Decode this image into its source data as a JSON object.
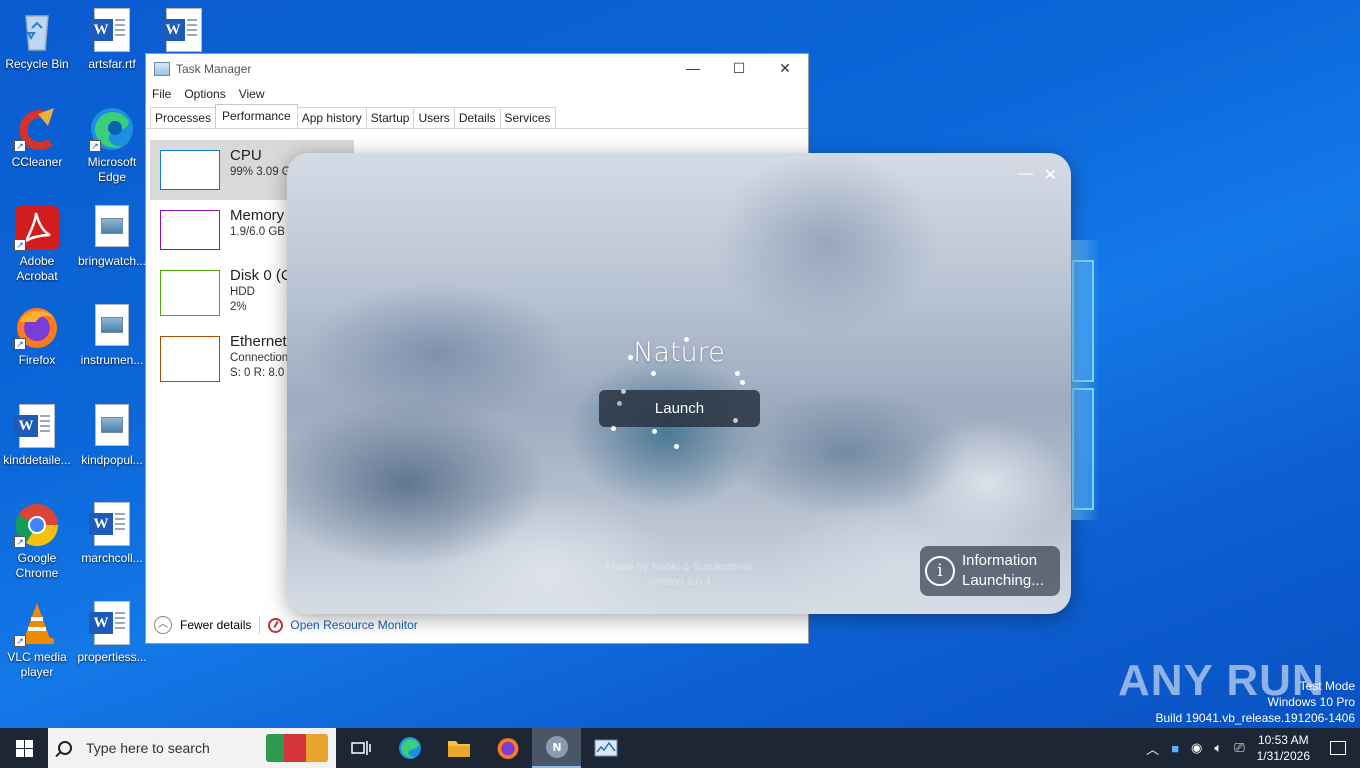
{
  "desktop": {
    "icons": [
      {
        "label": "Recycle Bin"
      },
      {
        "label": "artsfar.rtf"
      },
      {
        "label": ""
      },
      {
        "label": "CCleaner"
      },
      {
        "label": "Microsoft Edge"
      },
      {
        "label": "Adobe Acrobat"
      },
      {
        "label": "bringwatch..."
      },
      {
        "label": "Firefox"
      },
      {
        "label": "instrumen..."
      },
      {
        "label": "kinddetaile..."
      },
      {
        "label": "kindpopul..."
      },
      {
        "label": "Google Chrome"
      },
      {
        "label": "marchcoll..."
      },
      {
        "label": "VLC media player"
      },
      {
        "label": "propertiess..."
      }
    ]
  },
  "task_manager": {
    "title": "Task Manager",
    "menu": [
      "File",
      "Options",
      "View"
    ],
    "tabs": [
      "Processes",
      "Performance",
      "App history",
      "Startup",
      "Users",
      "Details",
      "Services"
    ],
    "active_tab": "Performance",
    "resources": [
      {
        "name": "CPU",
        "line1": "99%  3.09 GHz",
        "line2": "",
        "color": "#117dbb"
      },
      {
        "name": "Memory",
        "line1": "1.9/6.0 GB (32%)",
        "line2": "",
        "color": "#8b12ae"
      },
      {
        "name": "Disk 0 (C:)",
        "line1": "HDD",
        "line2": "2%",
        "color": "#4da60c"
      },
      {
        "name": "Ethernet",
        "line1": "Connection",
        "line2": "S: 0 R: 8.0 Kbps",
        "color": "#a74f01"
      }
    ],
    "footer": {
      "fewer_details": "Fewer details",
      "open_resource_monitor": "Open Resource Monitor"
    }
  },
  "launcher": {
    "title": "Nature",
    "launch_button": "Launch",
    "credits_line1": "Made by Naoki & Surukotonai",
    "credits_line2": "Version 1.0.4",
    "info_title": "Information",
    "info_status": "Launching..."
  },
  "watermark": {
    "brand": "ANY RUN",
    "test_mode": "Test Mode",
    "os": "Windows 10 Pro",
    "build": "Build 19041.vb_release.191206-1406"
  },
  "taskbar": {
    "search_placeholder": "Type here to search",
    "time": "10:53 AM",
    "date": "1/31/2026"
  },
  "colors": {
    "taskbar": "#1c2635",
    "desktop_blue": "#0b66d8",
    "tm_selected": "#d9d9d9"
  }
}
